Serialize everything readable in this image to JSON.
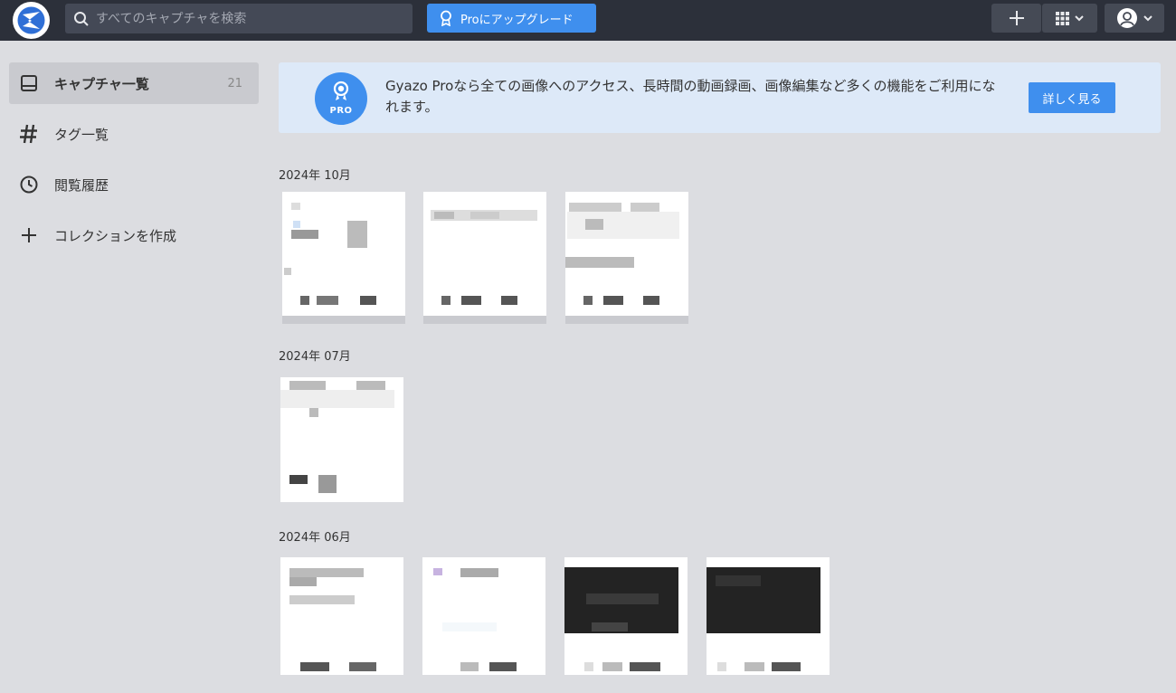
{
  "header": {
    "search_placeholder": "すべてのキャプチャを検索",
    "pro_button_label": "Proにアップグレード"
  },
  "sidebar": {
    "items": [
      {
        "label": "キャプチャ一覧",
        "count": "21"
      },
      {
        "label": "タグ一覧"
      },
      {
        "label": "閲覧履歴"
      },
      {
        "label": "コレクションを作成"
      }
    ]
  },
  "banner": {
    "badge_text": "PRO",
    "message": "Gyazo Proなら全ての画像へのアクセス、長時間の動画録画、画像編集など多くの機能をご利用になれます。",
    "button_label": "詳しく見る"
  },
  "groups": [
    {
      "month": "2024年 10月",
      "captures": 3
    },
    {
      "month": "2024年 07月",
      "captures": 1
    },
    {
      "month": "2024年 06月",
      "captures": 4
    }
  ],
  "colors": {
    "topbar": "#2c303a",
    "accent": "#3f8fee",
    "page_bg": "#dcdde1",
    "banner_bg": "#dde9f8"
  }
}
